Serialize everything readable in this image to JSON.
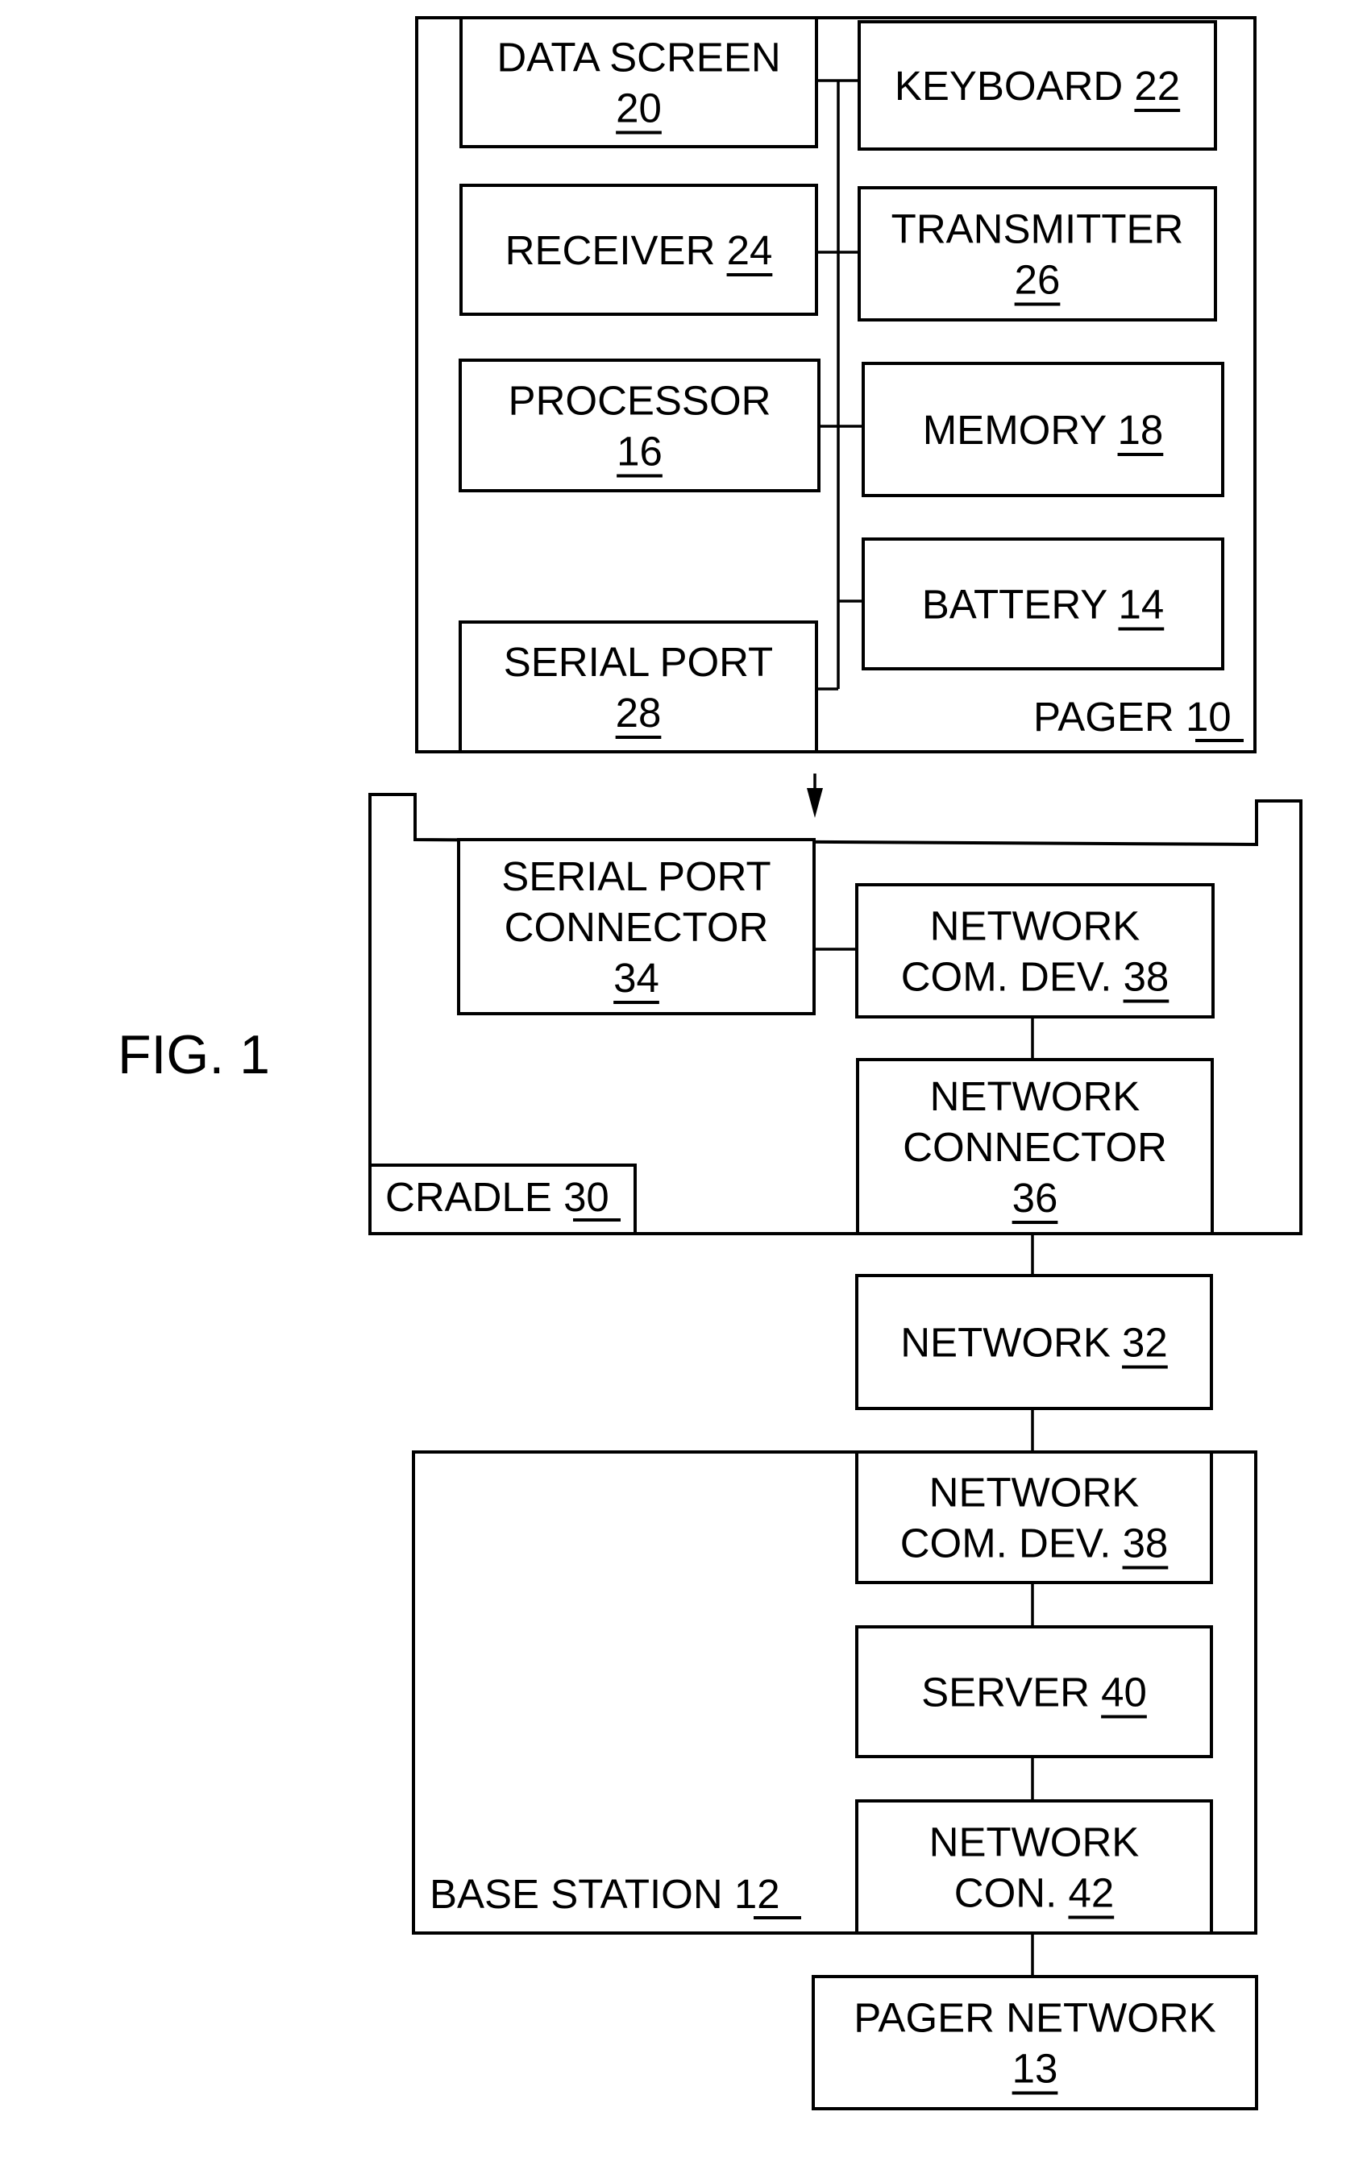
{
  "figure": {
    "label": "FIG. 1"
  },
  "containers": {
    "pager": {
      "name": "PAGER",
      "ref": "10"
    },
    "cradle": {
      "name": "CRADLE",
      "ref": "30"
    },
    "base_station": {
      "name": "BASE STATION",
      "ref": "12"
    }
  },
  "blocks": {
    "data_screen": {
      "lines": [
        "DATA SCREEN"
      ],
      "ref": "20",
      "ref_inline": false
    },
    "keyboard": {
      "lines": [
        "KEYBOARD"
      ],
      "ref": "22",
      "ref_inline": true
    },
    "receiver": {
      "lines": [
        "RECEIVER"
      ],
      "ref": "24",
      "ref_inline": true
    },
    "transmitter": {
      "lines": [
        "TRANSMITTER"
      ],
      "ref": "26",
      "ref_inline": false
    },
    "processor": {
      "lines": [
        "PROCESSOR"
      ],
      "ref": "16",
      "ref_inline": false
    },
    "memory": {
      "lines": [
        "MEMORY"
      ],
      "ref": "18",
      "ref_inline": true
    },
    "battery": {
      "lines": [
        "BATTERY"
      ],
      "ref": "14",
      "ref_inline": true
    },
    "serial_port": {
      "lines": [
        "SERIAL PORT"
      ],
      "ref": "28",
      "ref_inline": false
    },
    "serial_port_connector": {
      "lines": [
        "SERIAL PORT",
        "CONNECTOR"
      ],
      "ref": "34",
      "ref_inline": false
    },
    "cradle_network_com_dev": {
      "lines": [
        "NETWORK",
        "COM. DEV."
      ],
      "ref": "38",
      "ref_inline": true
    },
    "network_connector": {
      "lines": [
        "NETWORK",
        "CONNECTOR"
      ],
      "ref": "36",
      "ref_inline": false
    },
    "network": {
      "lines": [
        "NETWORK "
      ],
      "ref": "32",
      "ref_inline": true
    },
    "base_network_com_dev": {
      "lines": [
        "NETWORK",
        "COM. DEV."
      ],
      "ref": "38",
      "ref_inline": true
    },
    "server": {
      "lines": [
        "SERVER"
      ],
      "ref": "40",
      "ref_inline": true
    },
    "network_con": {
      "lines": [
        "NETWORK",
        "CON."
      ],
      "ref": "42",
      "ref_inline": true
    },
    "pager_network": {
      "lines": [
        "PAGER NETWORK"
      ],
      "ref": "13",
      "ref_inline": false
    }
  },
  "connections": [
    [
      "data_screen",
      "bus"
    ],
    [
      "keyboard",
      "bus"
    ],
    [
      "receiver",
      "bus"
    ],
    [
      "transmitter",
      "bus"
    ],
    [
      "processor",
      "bus"
    ],
    [
      "memory",
      "bus"
    ],
    [
      "battery",
      "bus"
    ],
    [
      "serial_port",
      "bus"
    ],
    [
      "serial_port",
      "serial_port_connector"
    ],
    [
      "serial_port_connector",
      "cradle_network_com_dev"
    ],
    [
      "cradle_network_com_dev",
      "network_connector"
    ],
    [
      "network_connector",
      "network"
    ],
    [
      "network",
      "base_network_com_dev"
    ],
    [
      "base_network_com_dev",
      "server"
    ],
    [
      "server",
      "network_con"
    ],
    [
      "network_con",
      "pager_network"
    ]
  ]
}
